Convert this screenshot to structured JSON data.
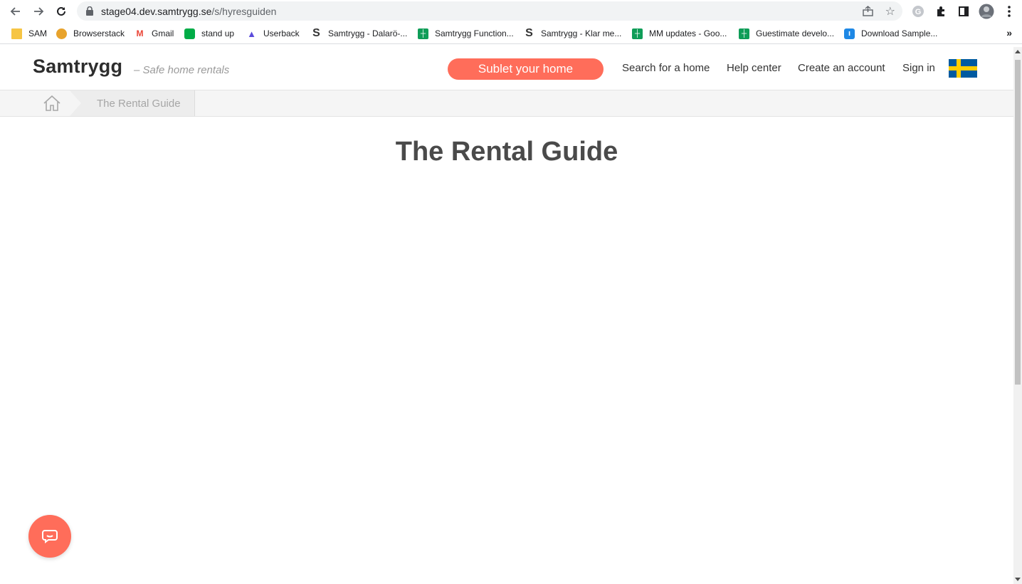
{
  "browser": {
    "url_host": "stage04.dev.samtrygg.se",
    "url_path": "/s/hyresguiden",
    "bookmarks": [
      {
        "label": "SAM",
        "icon": "folder-icon",
        "color": "#f6c544"
      },
      {
        "label": "Browserstack",
        "icon": "browserstack-icon",
        "color": "#e8a32c"
      },
      {
        "label": "Gmail",
        "icon": "gmail-icon",
        "color": "#ea4335"
      },
      {
        "label": "stand up",
        "icon": "meet-icon",
        "color": "#00ac47"
      },
      {
        "label": "Userback",
        "icon": "userback-icon",
        "color": "#5b4bdb"
      },
      {
        "label": "Samtrygg - Dalarö-...",
        "icon": "samtrygg-s-icon",
        "color": "#333333"
      },
      {
        "label": "Samtrygg Function...",
        "icon": "sheets-icon",
        "color": "#0f9d58"
      },
      {
        "label": "Samtrygg - Klar me...",
        "icon": "samtrygg-s-icon",
        "color": "#333333"
      },
      {
        "label": "MM updates - Goo...",
        "icon": "sheets-icon",
        "color": "#0f9d58"
      },
      {
        "label": "Guestimate develo...",
        "icon": "sheets-icon",
        "color": "#0f9d58"
      },
      {
        "label": "Download Sample...",
        "icon": "download-icon",
        "color": "#1e88e5"
      }
    ],
    "more_bookmarks": "»"
  },
  "header": {
    "logo": "Samtrygg",
    "tagline": "– Safe home rentals",
    "cta_label": "Sublet your home",
    "nav": [
      "Search for a home",
      "Help center",
      "Create an account",
      "Sign in"
    ],
    "language_flag": "sweden-flag-icon"
  },
  "breadcrumb": {
    "home_icon": "home-icon",
    "current": "The Rental Guide"
  },
  "main": {
    "title": "The Rental Guide"
  },
  "chat": {
    "icon": "chat-bubble-icon"
  },
  "colors": {
    "accent": "#ff6d5a",
    "title": "#4a4a4a"
  }
}
